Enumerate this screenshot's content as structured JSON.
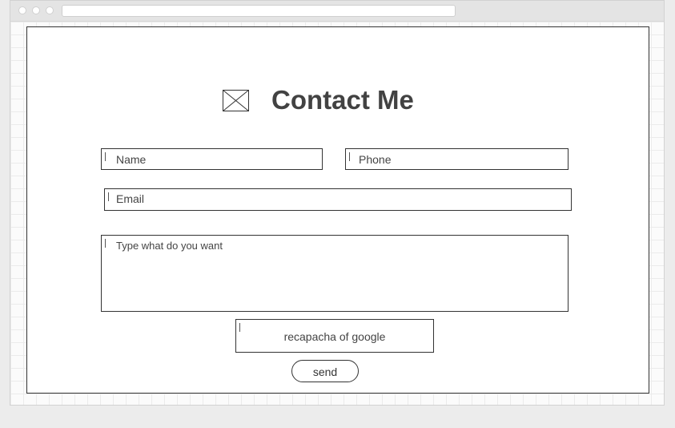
{
  "header": {
    "title": "Contact Me",
    "icon": "image-placeholder-icon"
  },
  "form": {
    "name_placeholder": "Name",
    "phone_placeholder": "Phone",
    "email_placeholder": "Email",
    "message_placeholder": "Type  what do you want",
    "captcha_label": "recapacha of google",
    "send_label": "send"
  },
  "colors": {
    "border": "#333333",
    "title": "#424242",
    "background": "#ececec"
  }
}
